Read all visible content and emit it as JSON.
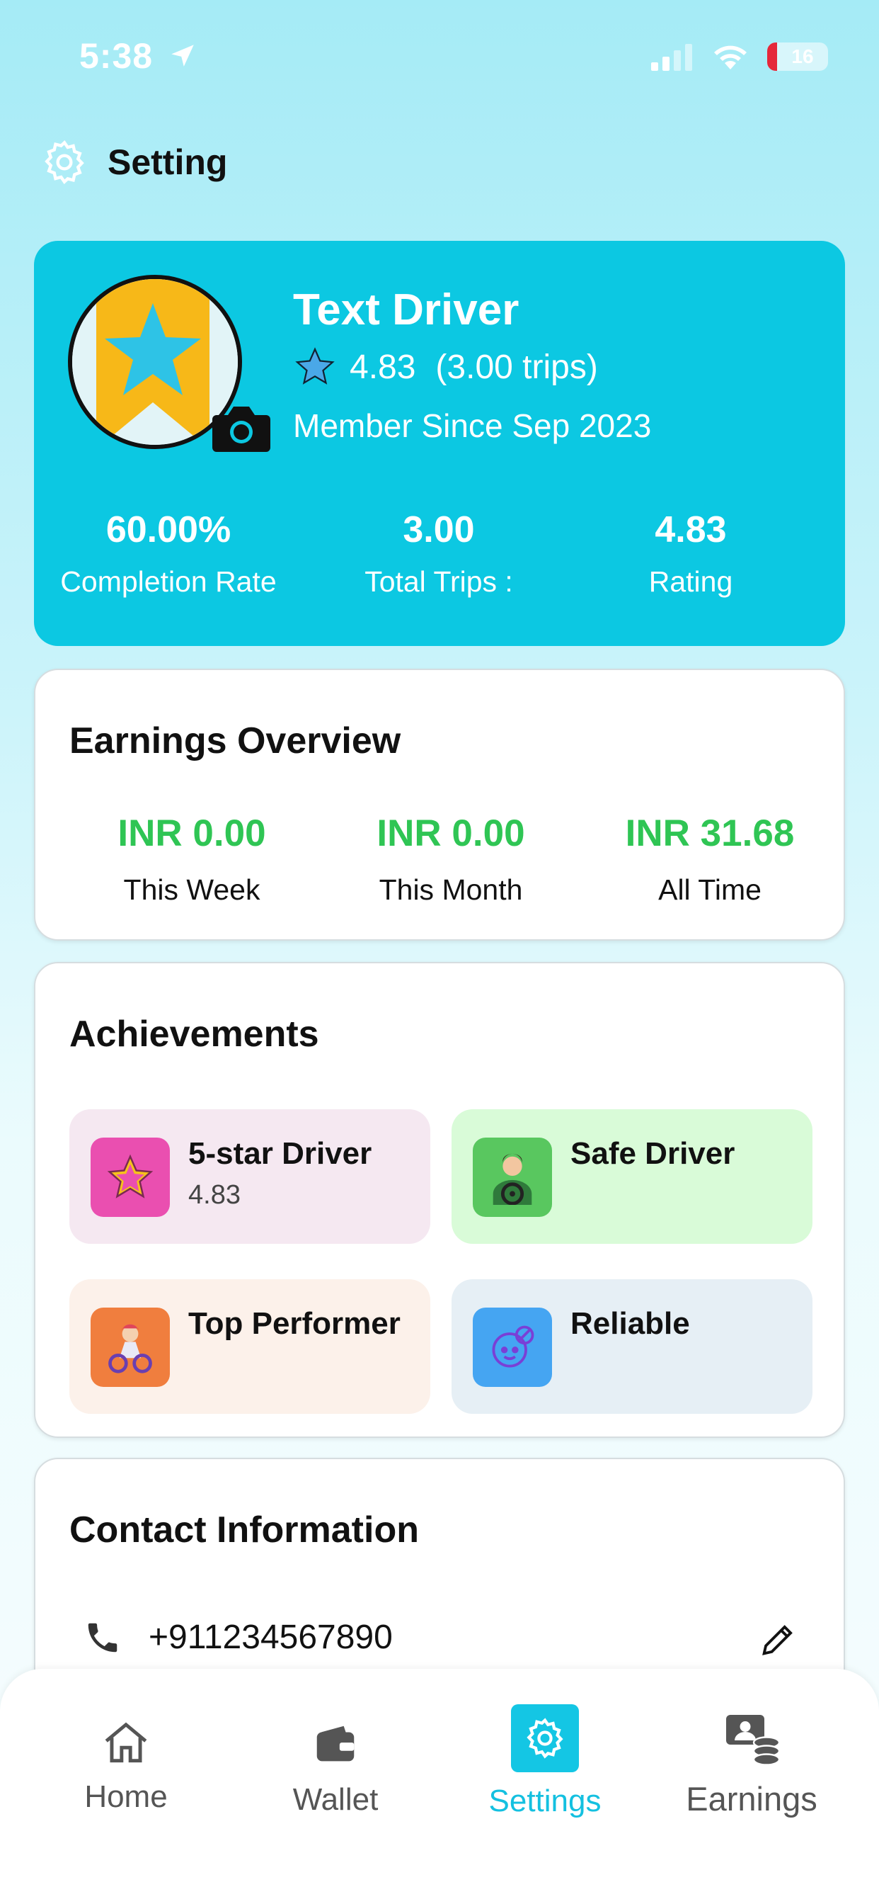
{
  "status_bar": {
    "time": "5:38",
    "battery": "16"
  },
  "header": {
    "title": "Setting"
  },
  "profile": {
    "name": "Text Driver",
    "rating": "4.83",
    "trips": "(3.00 trips)",
    "member_since": "Member Since Sep 2023",
    "stats": [
      {
        "value": "60.00%",
        "label": "Completion Rate"
      },
      {
        "value": "3.00",
        "label": "Total Trips :"
      },
      {
        "value": "4.83",
        "label": "Rating"
      }
    ]
  },
  "earnings": {
    "title": "Earnings Overview",
    "items": [
      {
        "value": "INR 0.00",
        "label": "This Week"
      },
      {
        "value": "INR 0.00",
        "label": "This Month"
      },
      {
        "value": "INR 31.68",
        "label": "All Time"
      }
    ]
  },
  "achievements": {
    "title": "Achievements",
    "items": [
      {
        "title": "5-star Driver",
        "subtitle": "4.83",
        "icon": "star-icon",
        "bg": "#f5e8f1",
        "icon_bg": "#ea4fb0"
      },
      {
        "title": "Safe Driver",
        "subtitle": "",
        "icon": "driver-icon",
        "bg": "#d9fbd8",
        "icon_bg": "#59c75f"
      },
      {
        "title": "Top Performer",
        "subtitle": "",
        "icon": "performer-icon",
        "bg": "#fcf1ea",
        "icon_bg": "#f07e3e"
      },
      {
        "title": "Reliable",
        "subtitle": "",
        "icon": "reliable-icon",
        "bg": "#e6eff5",
        "icon_bg": "#45a5f2"
      }
    ]
  },
  "contact": {
    "title": "Contact Information",
    "phone": "+911234567890"
  },
  "nav": {
    "items": [
      {
        "label": "Home",
        "icon": "home-icon"
      },
      {
        "label": "Wallet",
        "icon": "wallet-icon"
      },
      {
        "label": "Settings",
        "icon": "gear-icon",
        "active": true
      },
      {
        "label": "Earnings",
        "icon": "earnings-icon"
      }
    ]
  },
  "colors": {
    "accent": "#0cc8e2",
    "earnings_green": "#2fc554"
  }
}
